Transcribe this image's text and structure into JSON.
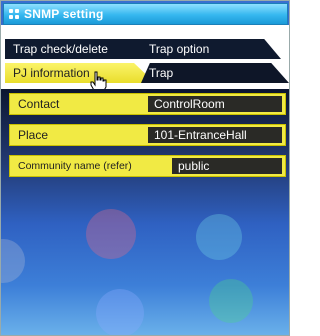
{
  "window": {
    "title": "SNMP setting"
  },
  "tabs": {
    "trap_check_delete": "Trap check/delete",
    "trap_option": "Trap option",
    "pj_information": "PJ information",
    "trap": "Trap"
  },
  "fields": {
    "contact": {
      "label": "Contact",
      "value": "ControlRoom"
    },
    "place": {
      "label": "Place",
      "value": "101-EntranceHall"
    },
    "community": {
      "label": "Community name (refer)",
      "value": "public"
    }
  },
  "icons": [
    "grid-icon",
    "hand-cursor-icon",
    "mail-icon",
    "gear-icon",
    "camera-icon",
    "wrench-icon"
  ]
}
